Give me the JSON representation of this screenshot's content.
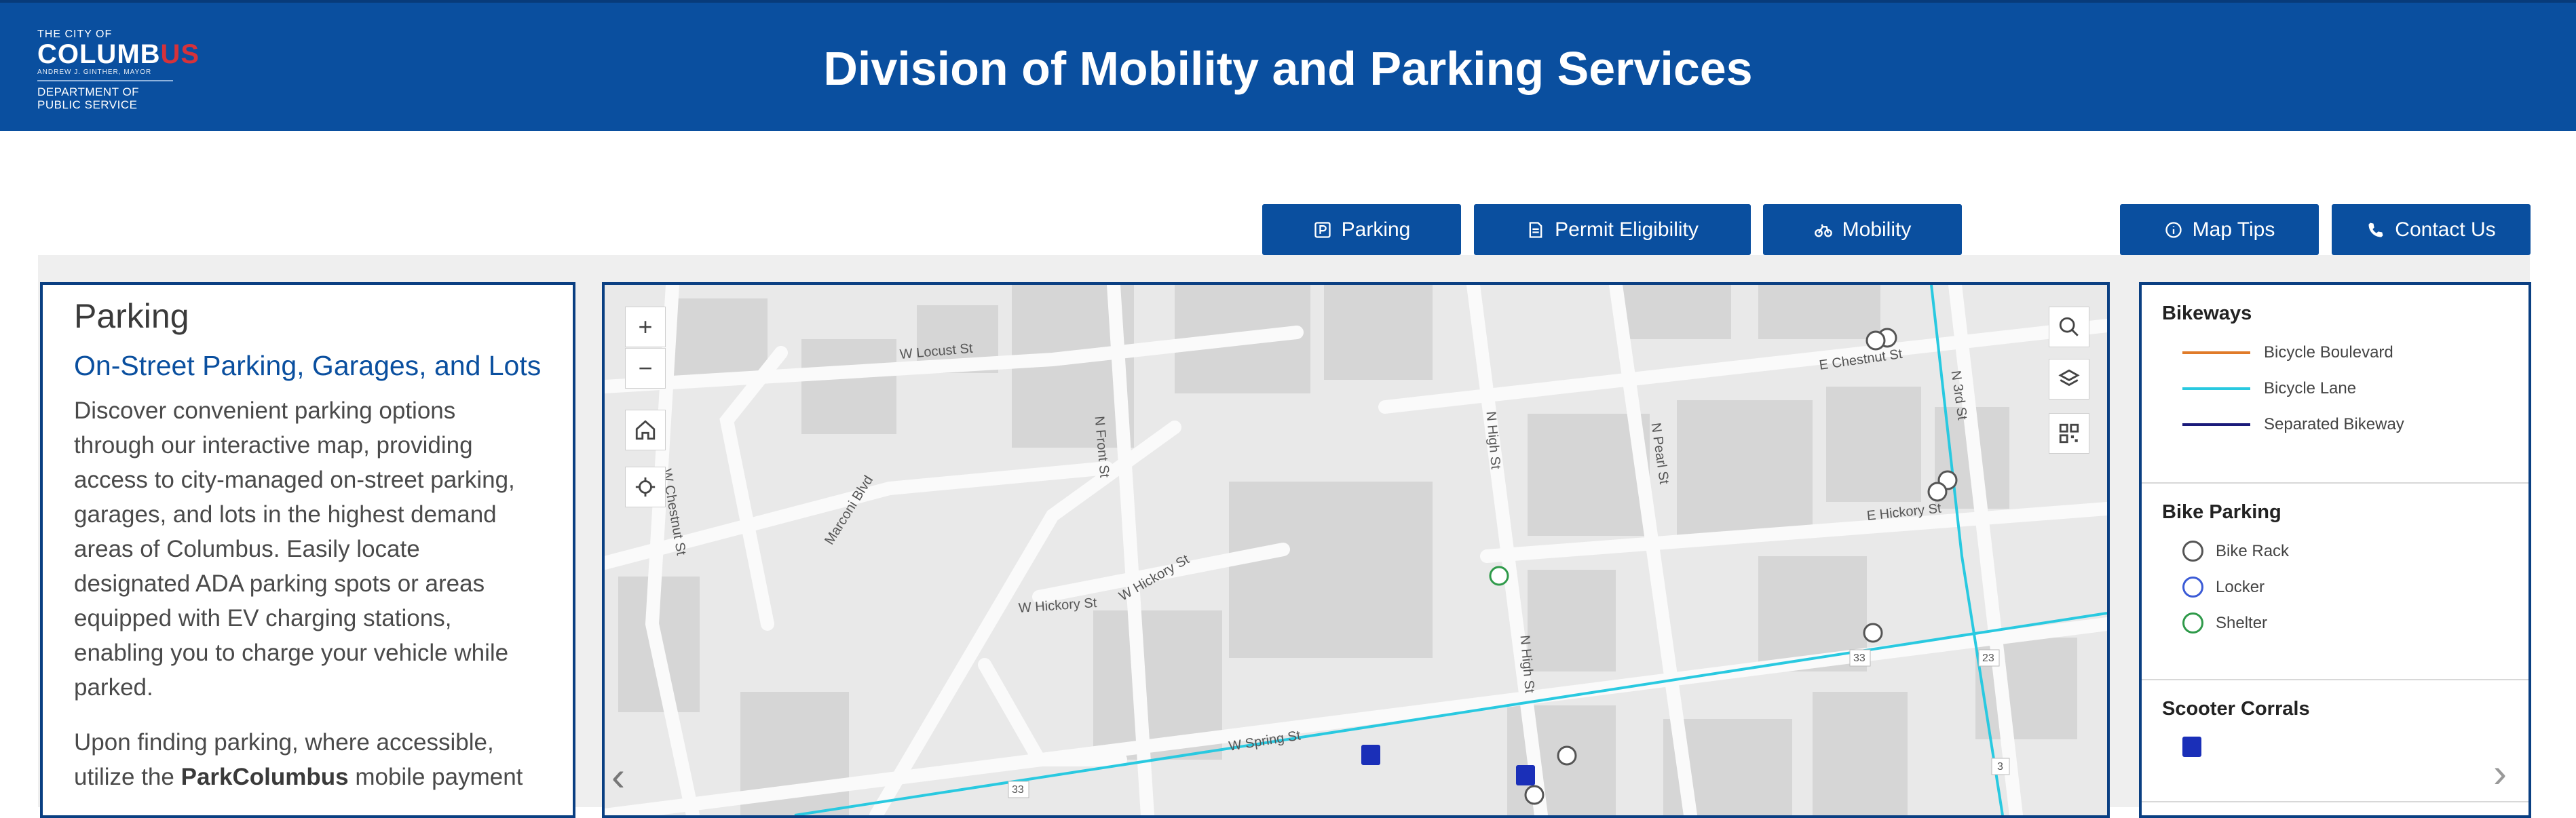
{
  "header": {
    "logo": {
      "line1": "THE CITY OF",
      "line2a": "COLUMB",
      "line2b": "US",
      "line3": "ANDREW J. GINTHER, MAYOR",
      "line4": "DEPARTMENT OF",
      "line5": "PUBLIC SERVICE"
    },
    "title": "Division of Mobility and Parking Services"
  },
  "nav": {
    "parking": "Parking",
    "permit": "Permit Eligibility",
    "mobility": "Mobility",
    "map_tips": "Map Tips",
    "contact": "Contact Us"
  },
  "panel": {
    "heading": "Parking",
    "subheading": "On-Street Parking, Garages, and Lots",
    "paragraph1": "Discover convenient parking options through our interactive map, providing access to city-managed on-street parking, garages, and lots in the highest demand areas of Columbus. Easily locate designated ADA parking spots or areas equipped with EV charging stations, enabling you to charge your vehicle while parked.",
    "paragraph2_pre": "Upon finding parking, where accessible, utilize the ",
    "paragraph2_bold": "ParkColumbus",
    "paragraph2_post": " mobile payment"
  },
  "map": {
    "streets": [
      "W Locust St",
      "W Chestnut St",
      "Marconi Blvd",
      "N Front St",
      "W Hickory St",
      "W Hickory St",
      "N High St",
      "N High St",
      "N Pearl St",
      "E Chestnut St",
      "N 3rd St",
      "E Hickory St",
      "W Spring St"
    ],
    "route_shields": [
      "33",
      "33",
      "23",
      "3"
    ],
    "colors": {
      "bike_lane": "#29c9e0",
      "background": "#e9e9e9",
      "building": "#d6d6d6",
      "road": "#fafafa"
    }
  },
  "legend": {
    "bikeways": {
      "title": "Bikeways",
      "items": [
        {
          "label": "Bicycle Boulevard",
          "color": "#e07b29"
        },
        {
          "label": "Bicycle Lane",
          "color": "#29c9e0"
        },
        {
          "label": "Separated Bikeway",
          "color": "#1a1a7a"
        }
      ]
    },
    "bike_parking": {
      "title": "Bike Parking",
      "items": [
        {
          "label": "Bike Rack",
          "color": "#555555"
        },
        {
          "label": "Locker",
          "color": "#3b5bd6"
        },
        {
          "label": "Shelter",
          "color": "#2f9a4a"
        }
      ]
    },
    "scooter": {
      "title": "Scooter Corrals"
    }
  }
}
